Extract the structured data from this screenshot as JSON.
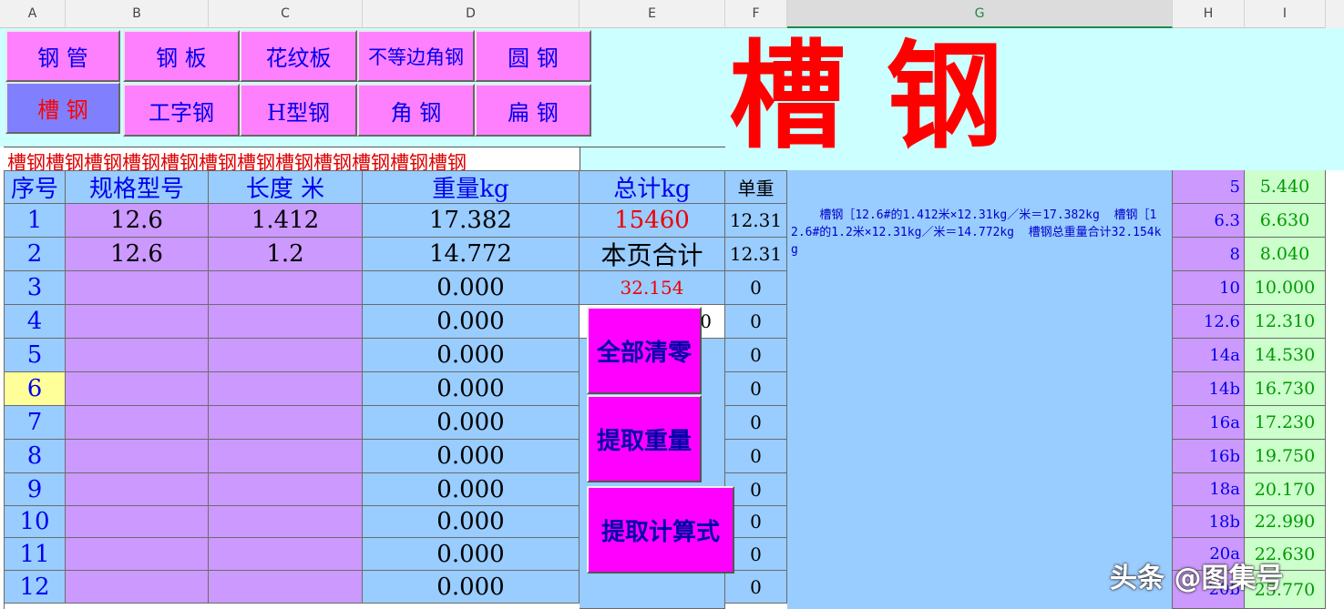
{
  "columns": [
    "A",
    "B",
    "C",
    "D",
    "E",
    "F",
    "G",
    "H",
    "I"
  ],
  "selected_column": "G",
  "nav": {
    "top": [
      "钢  管",
      "钢  板",
      "花纹板",
      "不等边角钢",
      "圆  钢"
    ],
    "bottom": [
      "槽  钢",
      "工字钢",
      "H型钢",
      "角  钢",
      "扁  钢"
    ]
  },
  "big_title": "槽 钢",
  "marquee": "槽钢槽钢槽钢槽钢槽钢槽钢槽钢槽钢槽钢槽钢槽钢槽钢",
  "table": {
    "headers": {
      "seq": "序号",
      "spec": "规格型号",
      "length": "长度 米",
      "weight": "重量kg",
      "total": "总计kg",
      "unit": "单重"
    },
    "rows": [
      {
        "seq": "1",
        "spec": "12.6",
        "length": "1.412",
        "weight": "17.382",
        "unit": "12.31"
      },
      {
        "seq": "2",
        "spec": "12.6",
        "length": "1.2",
        "weight": "14.772",
        "unit": "12.31"
      },
      {
        "seq": "3",
        "spec": "",
        "length": "",
        "weight": "0.000",
        "unit": "0"
      },
      {
        "seq": "4",
        "spec": "",
        "length": "",
        "weight": "0.000",
        "unit": "0"
      },
      {
        "seq": "5",
        "spec": "",
        "length": "",
        "weight": "0.000",
        "unit": "0"
      },
      {
        "seq": "6",
        "spec": "",
        "length": "",
        "weight": "0.000",
        "unit": "0"
      },
      {
        "seq": "7",
        "spec": "",
        "length": "",
        "weight": "0.000",
        "unit": "0"
      },
      {
        "seq": "8",
        "spec": "",
        "length": "",
        "weight": "0.000",
        "unit": "0"
      },
      {
        "seq": "9",
        "spec": "",
        "length": "",
        "weight": "0.000",
        "unit": "0"
      },
      {
        "seq": "10",
        "spec": "",
        "length": "",
        "weight": "0.000",
        "unit": "0"
      },
      {
        "seq": "11",
        "spec": "",
        "length": "",
        "weight": "0.000",
        "unit": "0"
      },
      {
        "seq": "12",
        "spec": "",
        "length": "",
        "weight": "0.000",
        "unit": "0"
      }
    ]
  },
  "total_value": "15460",
  "page_total_label": "本页合计",
  "page_total_value": "32.154",
  "e4_value": "0",
  "formula_text": "    槽钢［12.6#的1.412米×12.31kg／米＝17.382kg  槽钢［12.6#的1.2米×12.31kg／米＝14.772kg  槽钢总重量合计32.154kg",
  "actions": {
    "clear": "全部清零",
    "extract_weight": "提取重量",
    "extract_formula": "提取计算式"
  },
  "spec_table": [
    {
      "spec": "5",
      "weight": "5.440"
    },
    {
      "spec": "6.3",
      "weight": "6.630"
    },
    {
      "spec": "8",
      "weight": "8.040"
    },
    {
      "spec": "10",
      "weight": "10.000"
    },
    {
      "spec": "12.6",
      "weight": "12.310"
    },
    {
      "spec": "14a",
      "weight": "14.530"
    },
    {
      "spec": "14b",
      "weight": "16.730"
    },
    {
      "spec": "16a",
      "weight": "17.230"
    },
    {
      "spec": "16b",
      "weight": "19.750"
    },
    {
      "spec": "18a",
      "weight": "20.170"
    },
    {
      "spec": "18b",
      "weight": "22.990"
    },
    {
      "spec": "20a",
      "weight": "22.630"
    },
    {
      "spec": "20b",
      "weight": "25.770"
    }
  ],
  "watermark": "头条 @图集号",
  "colors": {
    "nav_pink": "#ff80ff",
    "nav_active": "#8080ff",
    "title_red": "#ff0000",
    "blue": "#99ccff",
    "purple": "#cc99ff",
    "green": "#ccffcc",
    "cyan": "#ccffff"
  }
}
